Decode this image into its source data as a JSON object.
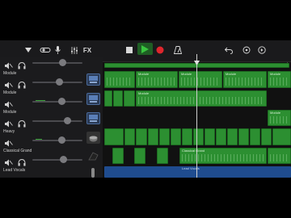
{
  "toolbar": {
    "fx_label": "FX",
    "colors": {
      "bg": "#1a1a1c",
      "play": "#39c43f",
      "record": "#e0262d"
    }
  },
  "tracks": [
    {
      "name": "",
      "volume": 0.52
    },
    {
      "name": "Module",
      "volume": 0.55
    },
    {
      "name": "Module",
      "volume": 0.55
    },
    {
      "name": "Module",
      "volume": 0.66
    },
    {
      "name": "Heavy",
      "volume": 0.55
    },
    {
      "name": "Classical Grand",
      "volume": 0.58
    },
    {
      "name": "Lead Vocals",
      "volume": 0.5
    }
  ],
  "regions": {
    "module_a": "Module",
    "module_b": "Module",
    "module_c": "Module",
    "module_d": "Module",
    "classical_a": "Classical Grand",
    "lead_vocals": "Lead Vocals"
  }
}
